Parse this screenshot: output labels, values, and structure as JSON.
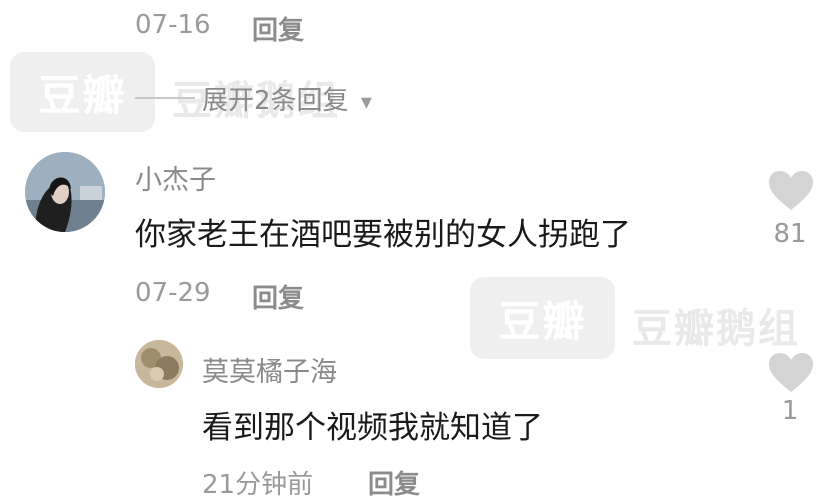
{
  "watermark": {
    "logo_text": "豆瓣",
    "group_text": "豆瓣鹅组"
  },
  "top_reply": {
    "date": "07-16",
    "reply_label": "回复"
  },
  "expand": {
    "label": "展开2条回复",
    "arrow": "▾"
  },
  "comment_main": {
    "username": "小杰子",
    "text": "你家老王在酒吧要被别的女人拐跑了",
    "likes": "81",
    "date": "07-29",
    "reply_label": "回复"
  },
  "comment_sub": {
    "username": "莫莫橘子海",
    "text": "看到那个视频我就知道了",
    "likes": "1",
    "time": "21分钟前",
    "reply_label": "回复"
  },
  "colors": {
    "meta": "#9a9a9a",
    "heart": "#d4d4d4",
    "watermark": "#efefef"
  }
}
